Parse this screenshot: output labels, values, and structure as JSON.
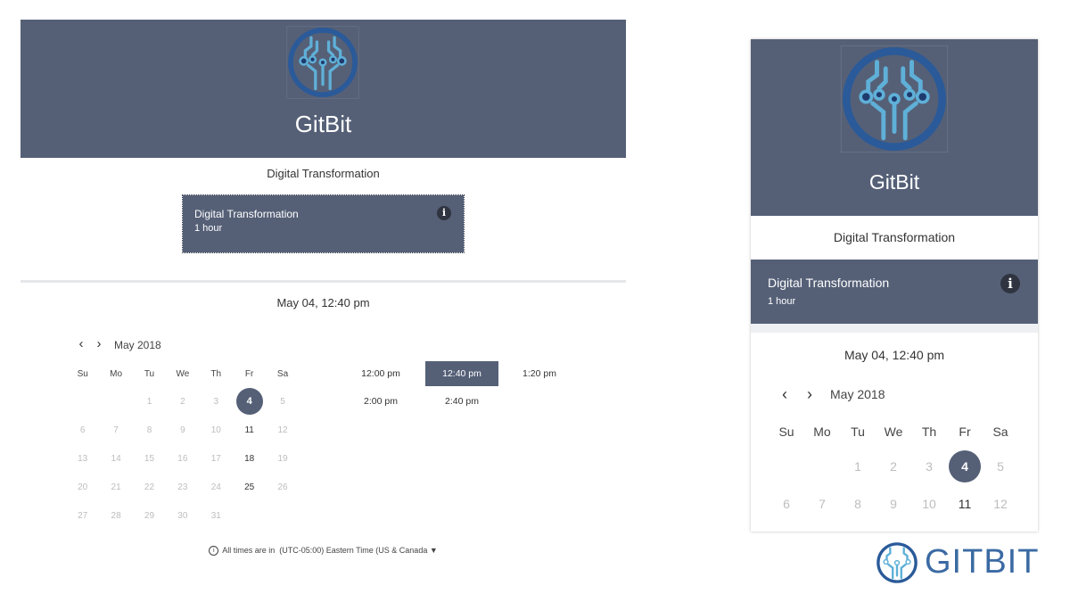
{
  "colors": {
    "header_bg": "#556077",
    "accent": "#556077",
    "logo_dark": "#2a5a99",
    "logo_light": "#5fb0d8",
    "brand_blue": "#3b6aa3",
    "unavailable_day": "#bdbdbd"
  },
  "icons": {
    "logo": "gitbit-circuit-logo-icon",
    "info": "info-icon",
    "prev": "chevron-left-icon",
    "next": "chevron-right-icon",
    "tz": "info-circle-icon",
    "tz_dropdown": "caret-down-icon"
  },
  "desktop": {
    "brand_name": "GitBit",
    "service_title": "Digital Transformation",
    "card": {
      "name": "Digital Transformation",
      "duration": "1 hour",
      "info_glyph": "i"
    },
    "selected_datetime": "May 04, 12:40 pm",
    "nav": {
      "prev": "‹",
      "next": "›"
    },
    "month_label": "May 2018",
    "weekdays": [
      "Su",
      "Mo",
      "Tu",
      "We",
      "Th",
      "Fr",
      "Sa"
    ],
    "weeks": [
      [
        "",
        "",
        "1",
        "2",
        "3",
        "4",
        "5"
      ],
      [
        "6",
        "7",
        "8",
        "9",
        "10",
        "11",
        "12"
      ],
      [
        "13",
        "14",
        "15",
        "16",
        "17",
        "18",
        "19"
      ],
      [
        "20",
        "21",
        "22",
        "23",
        "24",
        "25",
        "26"
      ],
      [
        "27",
        "28",
        "29",
        "30",
        "31",
        "",
        ""
      ]
    ],
    "available_days": [
      "4",
      "11",
      "18",
      "25"
    ],
    "selected_day": "4",
    "time_slots": [
      "12:00 pm",
      "12:40 pm",
      "1:20 pm",
      "2:00 pm",
      "2:40 pm"
    ],
    "selected_slot": "12:40 pm",
    "timezone": {
      "icon_glyph": "i",
      "prefix": "All times are in",
      "value": "(UTC-05:00) Eastern Time (US & Canada",
      "caret": "▼"
    }
  },
  "mobile": {
    "brand_name": "GitBit",
    "service_title": "Digital Transformation",
    "card": {
      "name": "Digital Transformation",
      "duration": "1 hour",
      "info_glyph": "i"
    },
    "selected_datetime": "May 04, 12:40 pm",
    "nav": {
      "prev": "‹",
      "next": "›"
    },
    "month_label": "May 2018",
    "weekdays": [
      "Su",
      "Mo",
      "Tu",
      "We",
      "Th",
      "Fr",
      "Sa"
    ],
    "weeks": [
      [
        "",
        "",
        "1",
        "2",
        "3",
        "4",
        "5"
      ],
      [
        "6",
        "7",
        "8",
        "9",
        "10",
        "11",
        "12"
      ]
    ],
    "available_days": [
      "4",
      "11"
    ],
    "selected_day": "4"
  },
  "brand_mark": {
    "word": "GITBIT"
  }
}
